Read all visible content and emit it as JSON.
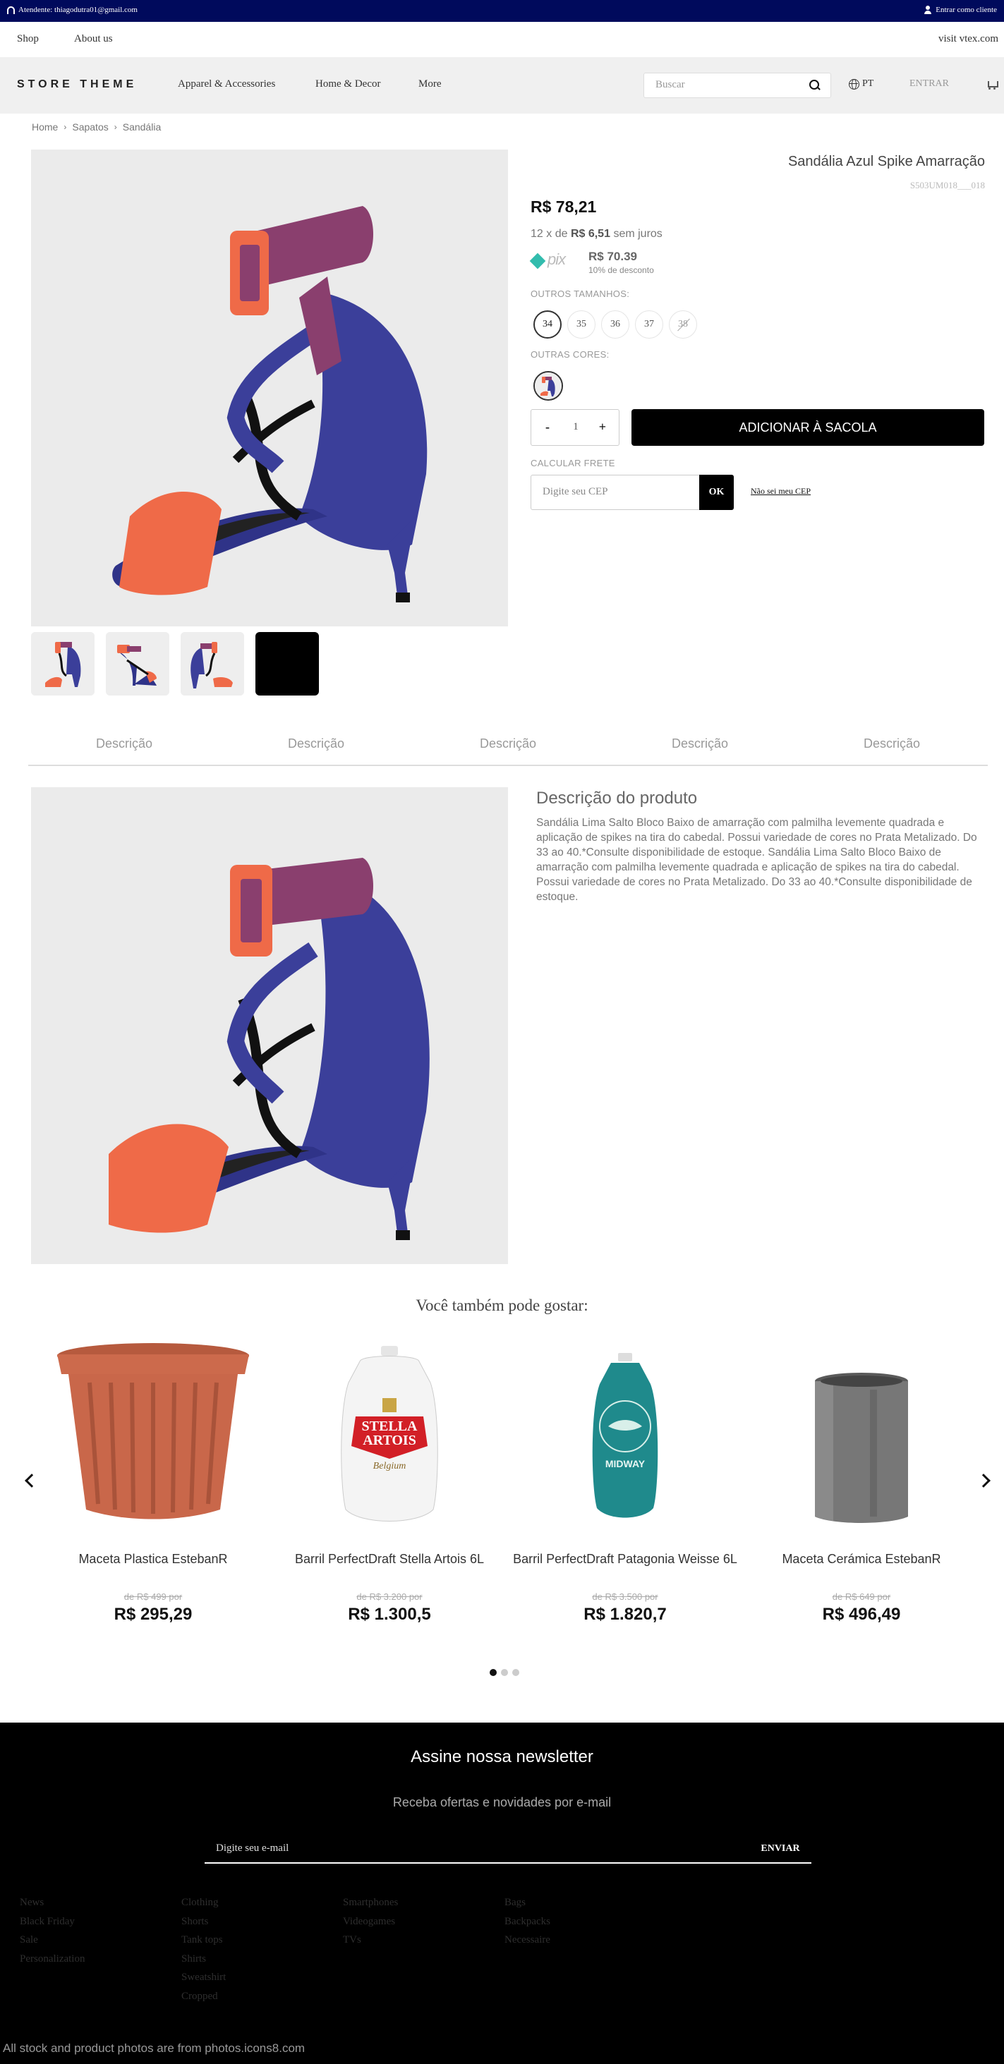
{
  "topbar": {
    "attendant": "Atendente: thiagodutra01@gmail.com",
    "login_client": "Entrar como cliente"
  },
  "subnav": {
    "shop": "Shop",
    "about": "About us",
    "visit": "visit vtex.com"
  },
  "header": {
    "logo": "STORE THEME",
    "menu": [
      "Apparel & Accessories",
      "Home & Decor",
      "More"
    ],
    "search_placeholder": "Buscar",
    "language": "PT",
    "login": "ENTRAR"
  },
  "breadcrumb": [
    "Home",
    "Sapatos",
    "Sandália"
  ],
  "product": {
    "name": "Sandália Azul Spike Amarração",
    "sku": "S503UM018___018",
    "price": "R$ 78,21",
    "installments_prefix": "12 x de",
    "installments_value": "R$ 6,51",
    "installments_suffix": "sem juros",
    "pix_logo": "pix",
    "pix_price": "R$ 70.39",
    "pix_discount": "10% de desconto",
    "sizes_label": "OUTROS TAMANHOS:",
    "sizes": [
      "34",
      "35",
      "36",
      "37",
      "38"
    ],
    "selected_size": "34",
    "colors_label": "OUTRAS CORES:",
    "quantity": "1",
    "add_to_cart": "ADICIONAR À SACOLA",
    "shipping_label": "CALCULAR FRETE",
    "cep_placeholder": "Digite seu CEP",
    "cep_button": "OK",
    "cep_unknown": "Não sei meu CEP"
  },
  "tabs": [
    "Descrição",
    "Descrição",
    "Descrição",
    "Descrição",
    "Descrição"
  ],
  "description": {
    "title": "Descrição do produto",
    "text": "Sandália Lima Salto Bloco Baixo de amarração com palmilha levemente quadrada e aplicação de spikes na tira do cabedal. Possui variedade de cores no Prata Metalizado. Do 33 ao 40.*Consulte disponibilidade de estoque. Sandália Lima Salto Bloco Baixo de amarração com palmilha levemente quadrada e aplicação de spikes na tira do cabedal. Possui variedade de cores no Prata Metalizado. Do 33 ao 40.*Consulte disponibilidade de estoque."
  },
  "recommendations": {
    "title": "Você também pode gostar:",
    "items": [
      {
        "name": "Maceta Plastica EstebanR",
        "old_price": "de R$ 499 por",
        "price": "R$ 295,29"
      },
      {
        "name": "Barril PerfectDraft Stella Artois 6L",
        "old_price": "de R$ 3.200 por",
        "price": "R$ 1.300,5"
      },
      {
        "name": "Barril PerfectDraft Patagonia Weisse 6L",
        "old_price": "de R$ 3.500 por",
        "price": "R$ 1.820,7"
      },
      {
        "name": "Maceta Cerámica EstebanR",
        "old_price": "de R$ 649 por",
        "price": "R$ 496,49"
      }
    ],
    "stella_label_1": "STELLA",
    "stella_label_2": "ARTOIS",
    "stella_sub": "Belgium",
    "midway_label": "MIDWAY"
  },
  "newsletter": {
    "title": "Assine nossa newsletter",
    "subtitle": "Receba ofertas e novidades por e-mail",
    "placeholder": "Digite seu e-mail",
    "button": "ENVIAR"
  },
  "footer": {
    "col1": [
      "News",
      "Black Friday",
      "Sale",
      "Personalization"
    ],
    "col2": [
      "Clothing",
      "Shorts",
      "Tank tops",
      "Shirts",
      "Sweatshirt",
      "Cropped"
    ],
    "col3": [
      "Smartphones",
      "Videogames",
      "TVs"
    ],
    "col4": [
      "Bags",
      "Backpacks",
      "Necessaire"
    ],
    "credit": "All stock and product photos are from photos.icons8.com"
  },
  "colors": {
    "topbar": "#000a5c",
    "accent_pix": "#32bcad",
    "button": "#000000"
  }
}
